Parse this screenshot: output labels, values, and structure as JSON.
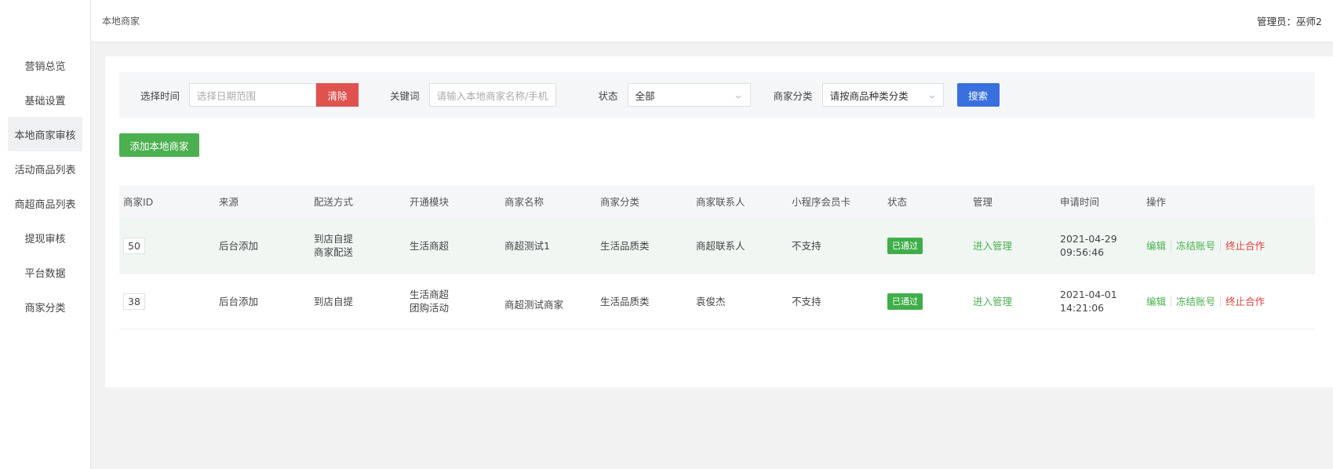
{
  "sidebar": {
    "items": [
      {
        "label": "营销总览"
      },
      {
        "label": "基础设置"
      },
      {
        "label": "本地商家审核"
      },
      {
        "label": "活动商品列表"
      },
      {
        "label": "商超商品列表"
      },
      {
        "label": "提现审核"
      },
      {
        "label": "平台数据"
      },
      {
        "label": "商家分类"
      }
    ],
    "active_index": 2
  },
  "header": {
    "title": "本地商家",
    "admin": "管理员：巫师2"
  },
  "filter": {
    "time_label": "选择时间",
    "time_placeholder": "选择日期范围",
    "clear_label": "清除",
    "keyword_label": "关键词",
    "keyword_placeholder": "请输入本地商家名称/手机",
    "status_label": "状态",
    "status_value": "全部",
    "category_label": "商家分类",
    "category_value": "请按商品种类分类",
    "search_label": "搜索"
  },
  "add_button": "添加本地商家",
  "table": {
    "columns": [
      "商家ID",
      "来源",
      "配送方式",
      "开通模块",
      "商家名称",
      "商家分类",
      "商家联系人",
      "小程序会员卡",
      "状态",
      "管理",
      "申请时间",
      "操作"
    ],
    "rows": [
      {
        "id": "50",
        "source": "后台添加",
        "delivery": [
          "到店自提",
          "商家配送"
        ],
        "modules": [
          "生活商超"
        ],
        "name": "商超测试1",
        "category": "生活品质类",
        "contact": "商超联系人",
        "member_card": "不支持",
        "status": "已通过",
        "manage": "进入管理",
        "date": "2021-04-29",
        "time": "09:56:46",
        "op_edit": "编辑",
        "op_freeze": "冻结账号",
        "op_stop": "终止合作"
      },
      {
        "id": "38",
        "source": "后台添加",
        "delivery": [
          "到店自提"
        ],
        "modules": [
          "生活商超",
          "团购活动"
        ],
        "name": "商超测试商家",
        "category": "生活品质类",
        "contact": "袁俊杰",
        "member_card": "不支持",
        "status": "已通过",
        "manage": "进入管理",
        "date": "2021-04-01",
        "time": "14:21:06",
        "op_edit": "编辑",
        "op_freeze": "冻结账号",
        "op_stop": "终止合作"
      }
    ]
  },
  "icons": {
    "select_chevron": "chevron-down-icon"
  },
  "colors": {
    "clear": "#e0524f",
    "search": "#3a6fde",
    "add": "#4cb050",
    "badge": "#3fae49",
    "link": "#4caf50",
    "danger": "#e03b3b"
  }
}
